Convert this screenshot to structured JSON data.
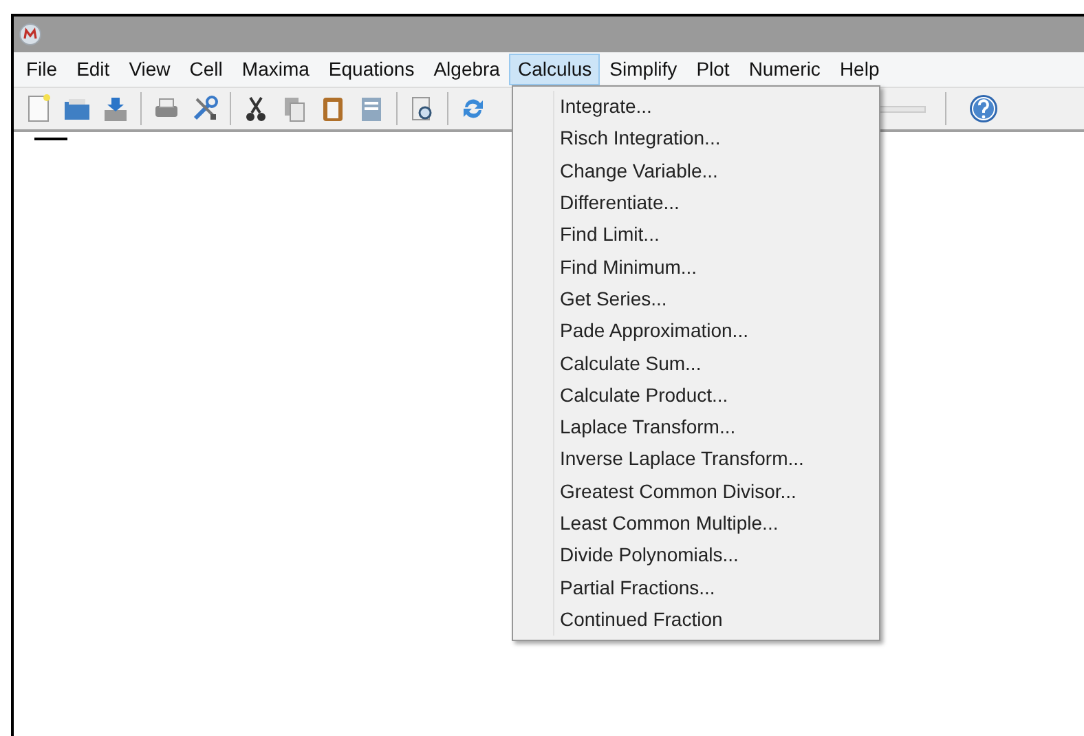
{
  "menu_bar": [
    {
      "label": "File",
      "selected": false
    },
    {
      "label": "Edit",
      "selected": false
    },
    {
      "label": "View",
      "selected": false
    },
    {
      "label": "Cell",
      "selected": false
    },
    {
      "label": "Maxima",
      "selected": false
    },
    {
      "label": "Equations",
      "selected": false
    },
    {
      "label": "Algebra",
      "selected": false
    },
    {
      "label": "Calculus",
      "selected": true
    },
    {
      "label": "Simplify",
      "selected": false
    },
    {
      "label": "Plot",
      "selected": false
    },
    {
      "label": "Numeric",
      "selected": false
    },
    {
      "label": "Help",
      "selected": false
    }
  ],
  "dropdown": {
    "items": [
      "Integrate...",
      "Risch Integration...",
      "Change Variable...",
      "Differentiate...",
      "Find Limit...",
      "Find Minimum...",
      "Get Series...",
      "Pade Approximation...",
      "Calculate Sum...",
      "Calculate Product...",
      "Laplace Transform...",
      "Inverse Laplace Transform...",
      "Greatest Common Divisor...",
      "Least Common Multiple...",
      "Divide Polynomials...",
      "Partial Fractions...",
      "Continued Fraction"
    ]
  }
}
